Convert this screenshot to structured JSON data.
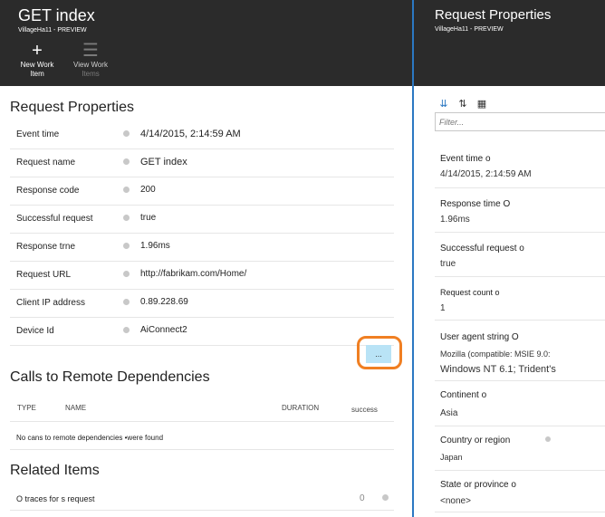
{
  "left": {
    "title": "GET index",
    "subtitle": "VillageHa11 - PREVIEW",
    "commands": {
      "new_icon": "+",
      "new_line1": "New Work",
      "new_line2": "Item",
      "view_icon": "☰",
      "view_line1": "View Work",
      "view_line2": "Items"
    },
    "request_section": "Request Properties",
    "properties": [
      {
        "label": "Event time",
        "value": "4/14/2015,  2:14:59 AM"
      },
      {
        "label": "Request name",
        "value": "GET index"
      },
      {
        "label": "Response code",
        "value": "200"
      },
      {
        "label": "Successful request",
        "value": "true"
      },
      {
        "label": "Response trne",
        "value": "1.96ms"
      },
      {
        "label": "Request URL",
        "value": "http://fabrikam.com/Home/"
      },
      {
        "label": "Client IP address",
        "value": "0.89.228.69"
      },
      {
        "label": "Device Id",
        "value": "AiConnect2"
      }
    ],
    "more_button": "...",
    "calls_section": "Calls to Remote Dependencies",
    "calls_columns": {
      "type": "TYPE",
      "name": "NAME",
      "duration": "DURATION",
      "success": "success"
    },
    "calls_empty": "No cans to remote dependencies •were found",
    "related_section": "Related  Items",
    "related_row": {
      "label": "O traces for s request",
      "count": "0"
    }
  },
  "right": {
    "title": "Request Properties",
    "subtitle": "VillageHa11 - PREVIEW",
    "toolbar": {
      "icon1": "⇊",
      "icon2": "⇅",
      "icon3": "▦"
    },
    "filter_placeholder": "Filter...",
    "items": [
      {
        "key": "Event time o",
        "value": "4/14/2015, 2:14:59 AM"
      },
      {
        "key": "Response time O",
        "value": "1.96ms"
      },
      {
        "key": "Successful request o",
        "value": "true"
      },
      {
        "key": "Request count o",
        "value": "1"
      },
      {
        "key": "User agent string O",
        "value": "Mozilla (compatible: MSIE 9.0:",
        "value2": "Windows NT 6.1; Trident's"
      },
      {
        "key": "Continent o",
        "value": "Asia"
      },
      {
        "key": "Country or region",
        "value": "Japan"
      },
      {
        "key": "State or province o",
        "value": "<none>"
      }
    ]
  }
}
